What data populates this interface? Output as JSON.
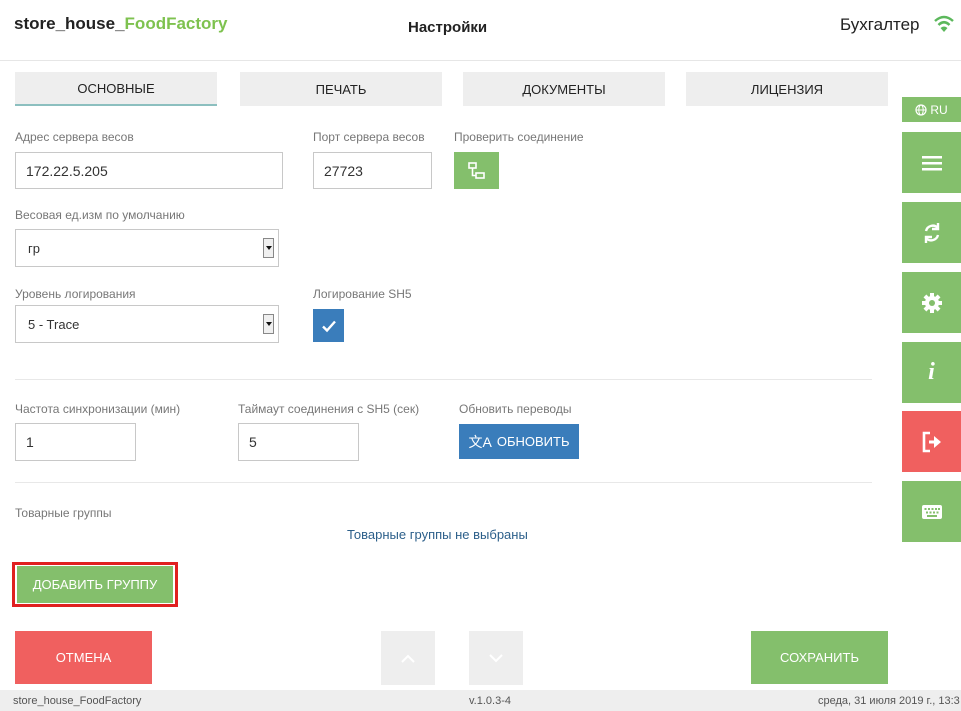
{
  "header": {
    "app_title_prefix": "store_house_",
    "app_title_accent": "FoodFactory",
    "page_title": "Настройки",
    "user_name": "Бухгалтер",
    "wifi_icon": "wifi-icon"
  },
  "tabs": [
    {
      "label": "ОСНОВНЫЕ",
      "active": true
    },
    {
      "label": "ПЕЧАТЬ",
      "active": false
    },
    {
      "label": "ДОКУМЕНТЫ",
      "active": false
    },
    {
      "label": "ЛИЦЕНЗИЯ",
      "active": false
    }
  ],
  "form": {
    "server_address_label": "Адрес сервера весов",
    "server_address_value": "172.22.5.205",
    "server_port_label": "Порт сервера весов",
    "server_port_value": "27723",
    "check_connection_label": "Проверить соединение",
    "check_connection_icon": "network-icon",
    "weight_unit_label": "Весовая ед.изм по умолчанию",
    "weight_unit_value": "гр",
    "log_level_label": "Уровень логирования",
    "log_level_value": "5 - Trace",
    "sh5_logging_label": "Логирование SH5",
    "sh5_logging_checked": true,
    "sync_freq_label": "Частота синхронизации (мин)",
    "sync_freq_value": "1",
    "sh5_timeout_label": "Таймаут соединения с SH5 (сек)",
    "sh5_timeout_value": "5",
    "update_translations_label": "Обновить переводы",
    "update_button_label": "ОБНОВИТЬ",
    "update_button_icon": "translate-icon",
    "product_groups_label": "Товарные группы",
    "product_groups_empty": "Товарные группы не выбраны",
    "add_group_button": "ДОБАВИТЬ ГРУППУ"
  },
  "actions": {
    "cancel": "ОТМЕНА",
    "save": "СОХРАНИТЬ",
    "up_icon": "chevron-up-icon",
    "down_icon": "chevron-down-icon"
  },
  "sidebar": {
    "language": "RU",
    "language_icon": "globe-icon",
    "items": [
      {
        "icon": "menu-icon"
      },
      {
        "icon": "sync-icon"
      },
      {
        "icon": "gear-icon"
      },
      {
        "icon": "info-icon"
      },
      {
        "icon": "logout-icon"
      },
      {
        "icon": "keyboard-icon"
      }
    ]
  },
  "footer": {
    "app_name": "store_house_FoodFactory",
    "version": "v.1.0.3-4",
    "datetime": "среда, 31 июля 2019 г., 13:3"
  },
  "colors": {
    "accent_green": "#84bf6c",
    "brand_green": "#7ec24f",
    "danger_red": "#f0605f",
    "primary_blue": "#3a7dbb",
    "highlight_red": "#e02020"
  }
}
